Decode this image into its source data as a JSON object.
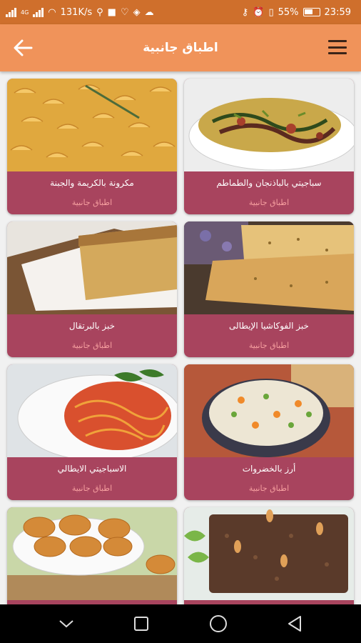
{
  "status_bar": {
    "network": "4G",
    "speed": "131K/s",
    "battery": "55%",
    "time": "23:59"
  },
  "app_bar": {
    "title": "اطباق جانبية",
    "back_icon": "arrow-left-icon",
    "menu_icon": "hamburger-menu-icon"
  },
  "recipes": [
    {
      "name": "سباجيتي بالباذنجان والطماطم",
      "category": "اطباق جانبية",
      "image": "spaghetti-eggplant"
    },
    {
      "name": "مكرونة بالكريمة والجبنة",
      "category": "اطباق جانبية",
      "image": "macaroni-cheese"
    },
    {
      "name": "خبز الفوكاشيا الإيطالى",
      "category": "اطباق جانبية",
      "image": "focaccia-bread"
    },
    {
      "name": "خبز بالبرتقال",
      "category": "اطباق جانبية",
      "image": "orange-bread"
    },
    {
      "name": "أرز بالخضروات",
      "category": "اطباق جانبية",
      "image": "vegetable-rice"
    },
    {
      "name": "الاسباجيتي الايطالي",
      "category": "اطباق جانبية",
      "image": "italian-spaghetti"
    },
    {
      "name": "",
      "category": "",
      "image": "brown-cake"
    },
    {
      "name": "",
      "category": "",
      "image": "chicken-nuggets"
    }
  ],
  "nav_bar": {
    "back": "triangle-back-icon",
    "home": "circle-home-icon",
    "recents": "square-recents-icon",
    "hide": "chevron-down-icon"
  },
  "colors": {
    "status_bar": "#cf6f2c",
    "app_bar": "#f0935a",
    "card": "#a8445e",
    "category_text": "#f7a0a0",
    "background": "#f1f1f1"
  }
}
